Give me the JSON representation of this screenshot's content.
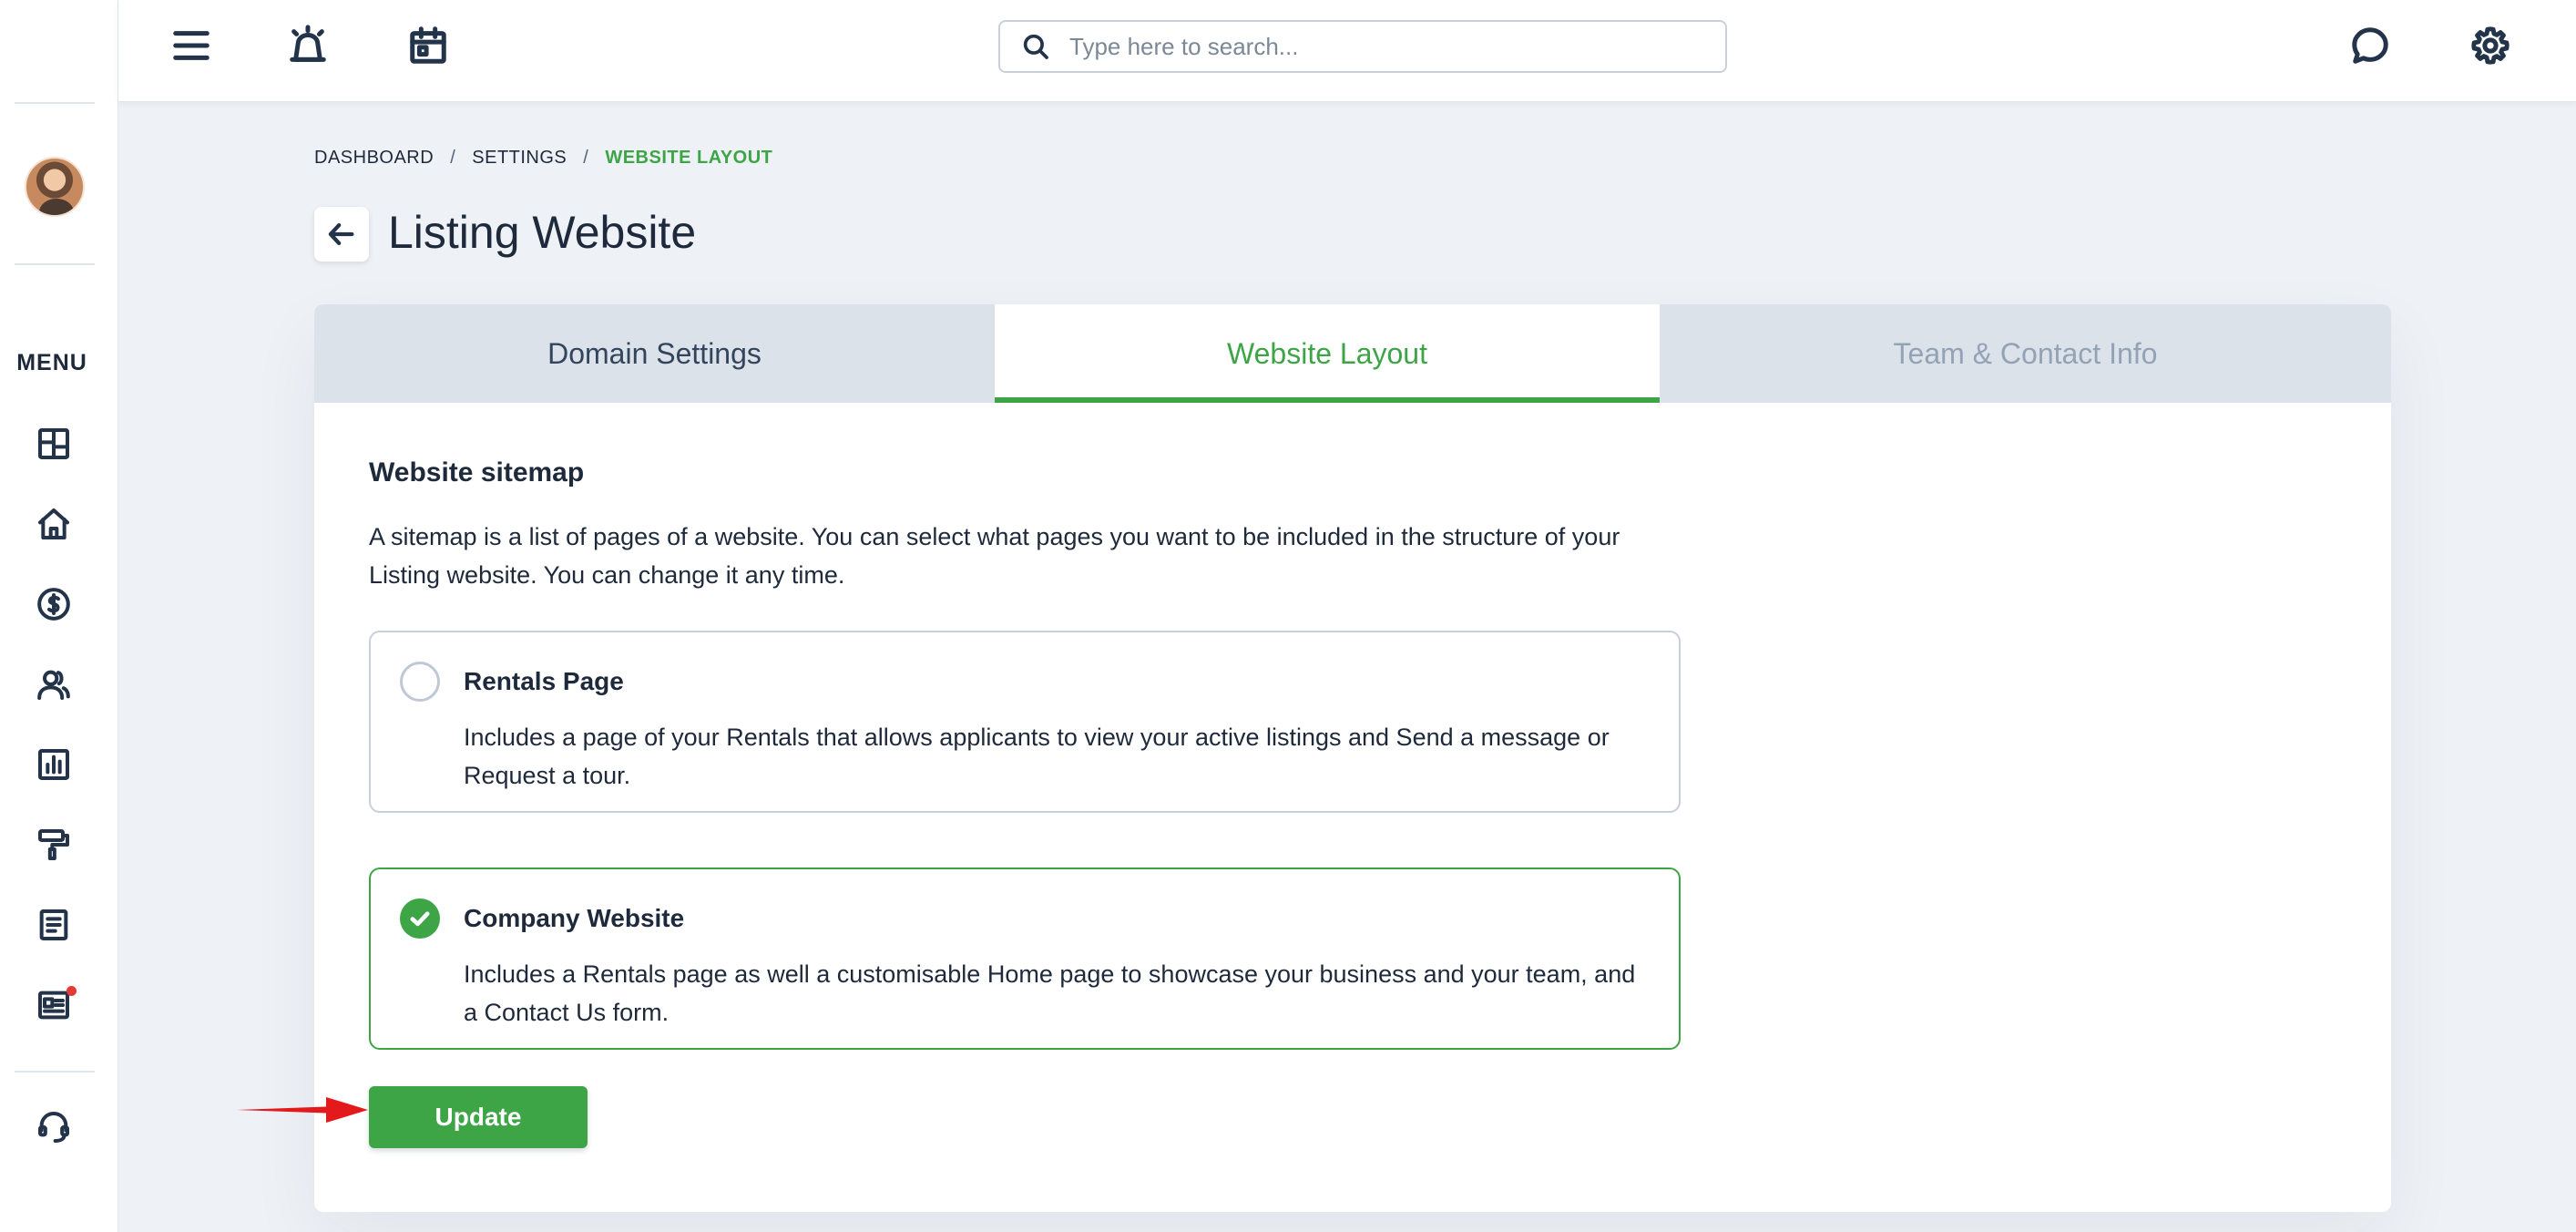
{
  "topbar": {
    "icons": [
      "menu-icon",
      "alarm-icon",
      "calendar-icon",
      "chat-icon",
      "gear-icon"
    ],
    "search": {
      "placeholder": "Type here to search...",
      "value": ""
    }
  },
  "sidebar": {
    "menu_label": "MENU",
    "items": [
      {
        "icon": "dashboard-icon"
      },
      {
        "icon": "home-icon"
      },
      {
        "icon": "dollar-icon"
      },
      {
        "icon": "users-icon"
      },
      {
        "icon": "reports-icon"
      },
      {
        "icon": "paint-roller-icon"
      },
      {
        "icon": "document-icon"
      },
      {
        "icon": "newsletter-icon",
        "has_notification": true
      },
      {
        "icon": "support-headset-icon"
      }
    ]
  },
  "breadcrumb": {
    "items": [
      "DASHBOARD",
      "SETTINGS",
      "WEBSITE LAYOUT"
    ],
    "separator": "/"
  },
  "page": {
    "title": "Listing Website"
  },
  "tabs": [
    {
      "label": "Domain Settings",
      "active": false
    },
    {
      "label": "Website Layout",
      "active": true
    },
    {
      "label": "Team & Contact Info",
      "active": false
    }
  ],
  "sitemap": {
    "title": "Website sitemap",
    "description": "A sitemap is a list of pages of a website. You can select what pages you want to be included in the structure of your Listing website. You can change it any time.",
    "options": [
      {
        "title": "Rentals Page",
        "description": "Includes a page of your Rentals that allows applicants to view your active listings and Send a message or Request a tour.",
        "selected": false
      },
      {
        "title": "Company Website",
        "description": "Includes a Rentals page as well a  customisable Home page to showcase your business and your team, and a Contact Us form.",
        "selected": true
      }
    ],
    "update_label": "Update"
  },
  "colors": {
    "accent": "#3da546",
    "text": "#1e2a3b",
    "background": "#eef1f6",
    "tab_inactive": "#dce2ea",
    "notification": "#e53935",
    "annotation_arrow": "#e3191c"
  }
}
